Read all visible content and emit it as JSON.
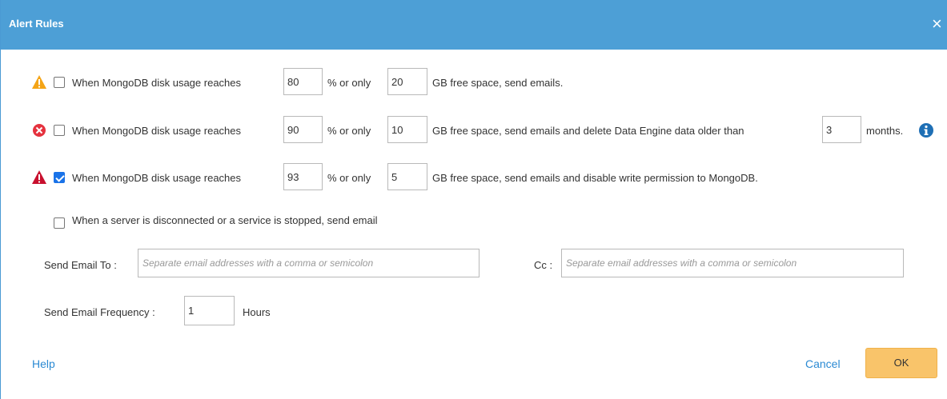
{
  "dialog": {
    "title": "Alert Rules",
    "close_glyph": "×"
  },
  "rules": [
    {
      "checked": false,
      "icon": "warning-triangle-icon",
      "prefix": "When MongoDB disk usage reaches",
      "percent": "80",
      "mid": "% or only",
      "gb": "20",
      "suffix": "GB free space, send emails."
    },
    {
      "checked": false,
      "icon": "error-circle-icon",
      "prefix": "When MongoDB disk usage reaches",
      "percent": "90",
      "mid": "% or only",
      "gb": "10",
      "suffix": "GB free space, send emails and delete Data Engine data older than",
      "months": "3",
      "months_label": "months."
    },
    {
      "checked": true,
      "icon": "danger-triangle-icon",
      "prefix": "When MongoDB disk usage reaches",
      "percent": "93",
      "mid": "% or only",
      "gb": "5",
      "suffix": "GB free space, send emails and disable write permission to MongoDB."
    }
  ],
  "server_rule": {
    "checked": false,
    "label": "When a server is disconnected or a service is stopped, send email"
  },
  "email": {
    "to_label": "Send Email To :",
    "to_placeholder": "Separate email addresses with a comma or semicolon",
    "cc_label": "Cc :",
    "cc_placeholder": "Separate email addresses with a comma or semicolon",
    "freq_label": "Send Email Frequency :",
    "freq_value": "1",
    "freq_unit": "Hours"
  },
  "footer": {
    "help": "Help",
    "cancel": "Cancel",
    "ok": "OK"
  },
  "colors": {
    "titlebar": "#4d9fd6",
    "warning": "#f4a416",
    "error": "#e5323e",
    "danger": "#c8102e",
    "info": "#1e6fb5",
    "ok_button": "#f9c46a",
    "link": "#2b8ad3"
  }
}
